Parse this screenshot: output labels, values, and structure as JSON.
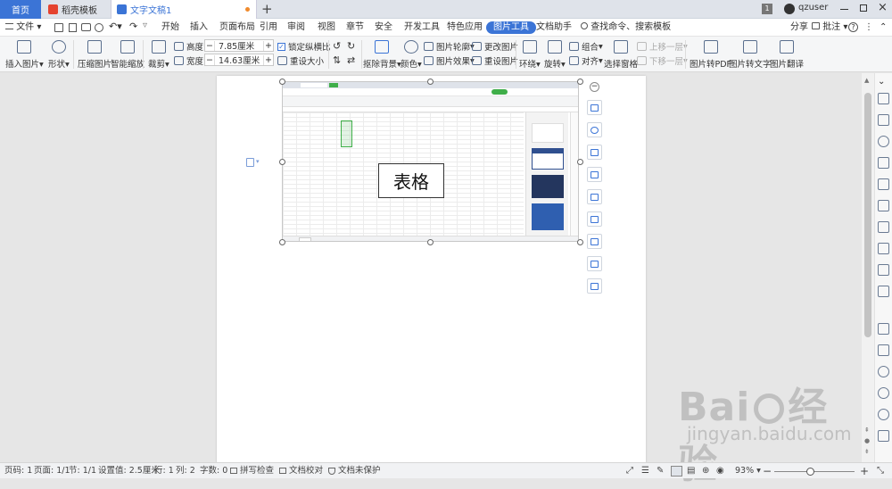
{
  "tabs": {
    "home": "首页",
    "daoke": "稻壳模板",
    "document": "文字文稿1",
    "add": "+",
    "badge": "1",
    "user": "qzuser"
  },
  "menu": {
    "file": "文件",
    "items": [
      "开始",
      "插入",
      "页面布局",
      "引用",
      "审阅",
      "视图",
      "章节",
      "安全",
      "开发工具",
      "特色应用",
      "图片工具",
      "文档助手"
    ],
    "active": "图片工具",
    "search": "查找命令、搜索模板",
    "share": "分享",
    "comment": "批注"
  },
  "ribbon": {
    "insert_picture": "插入图片",
    "shape": "形状",
    "compress": "压缩图片",
    "smart_zoom": "智能缩放",
    "crop": "裁剪",
    "height_label": "高度:",
    "height_value": "7.85厘米",
    "width_label": "宽度:",
    "width_value": "14.63厘米",
    "lock_ratio": "锁定纵横比",
    "reset_size": "重设大小",
    "remove_bg": "抠除背景",
    "color": "颜色",
    "outline": "图片轮廓",
    "effects": "图片效果",
    "change_picture": "更改图片",
    "reset_picture": "重设图片",
    "wrap": "环绕",
    "rotate": "旋转",
    "group": "组合",
    "align": "对齐",
    "selection_pane": "选择窗格",
    "bring_forward": "上移一层",
    "send_backward": "下移一层",
    "to_pdf": "图片转PDF",
    "to_text": "图片转文字",
    "translate": "图片翻译"
  },
  "document": {
    "image_text": "表格"
  },
  "status": {
    "page": "页码: 1",
    "pages": "页面: 1/1",
    "section": "节: 1/1",
    "setting": "设置值: 2.5厘米",
    "row": "行: 1",
    "col": "列: 2",
    "words": "字数: 0",
    "spell": "拼写检查",
    "proof": "文档校对",
    "protect": "文档未保护",
    "zoom": "93%"
  },
  "watermark": {
    "brand": "Bai",
    "brand2": "经验",
    "url": "jingyan.baidu.com"
  },
  "colors": {
    "accent": "#3b74d6",
    "wps_red": "#e5432f"
  }
}
